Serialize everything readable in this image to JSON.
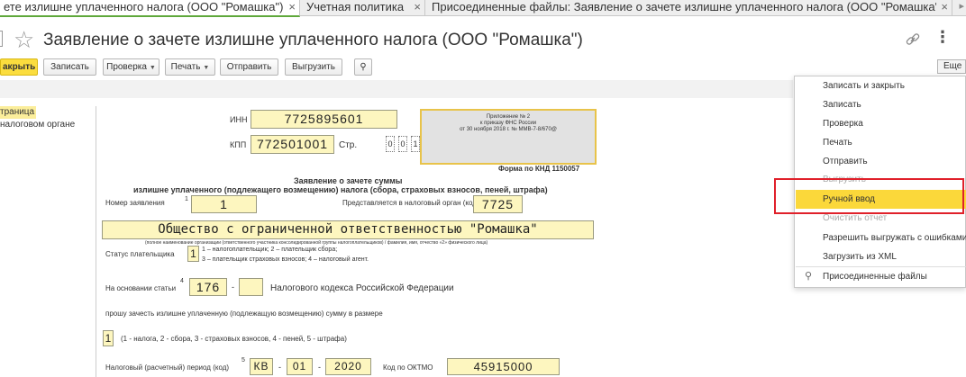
{
  "tabs": [
    {
      "label": "ете излишне уплаченного налога (ООО \"Ромашка\")",
      "close": "×"
    },
    {
      "label": "Учетная политика",
      "close": "×"
    },
    {
      "label": "Присоединенные файлы: Заявление о зачете излишне уплаченного налога (ООО \"Ромашка\")",
      "close": "×"
    }
  ],
  "tab_nav": {
    "arrow": "▸",
    "more": "⋮"
  },
  "title": "Заявление о зачете излишне уплаченного налога (ООО \"Ромашка\")",
  "toolbar": {
    "close_label": "акрыть",
    "save_label": "Записать",
    "check_label": "Проверка",
    "print_label": "Печать",
    "send_label": "Отправить",
    "export_label": "Выгрузить",
    "more_label": "Еще"
  },
  "left_panel": {
    "items": [
      "траница",
      "налоговом органе"
    ]
  },
  "form": {
    "inn_label": "ИНН",
    "inn": "7725895601",
    "kpp_label": "КПП",
    "kpp": "772501001",
    "page_label": "Стр.",
    "page_digits": [
      "0",
      "0",
      "1"
    ],
    "stamp_lines": [
      "Приложение № 2",
      "к приказу ФНС России",
      "от 30 ноября 2018 г. № ММВ-7-8/670@"
    ],
    "knd": "Форма по КНД 1150057",
    "heading1": "Заявление о зачете суммы",
    "heading2": "излишне уплаченного (подлежащего возмещению) налога (сбора, страховых взносов, пеней, штрафа)",
    "app_number_label": "Номер заявления",
    "app_number": "1",
    "tax_office_label": "Представляется в налоговый орган (код)",
    "tax_office": "7725",
    "org_name": "Общество с ограниченной ответственностью \"Ромашка\"",
    "org_hint": "(полное наименование организации (ответственного участника консолидированной группы налогоплательщиков) / фамилия, имя, отчество «2» физического лица)",
    "payer_status_label": "Статус плательщика",
    "payer_status": "1",
    "payer_status_hint1": "1 – налогоплательщик; 2 – плательщик сбора;",
    "payer_status_hint2": "3 – плательщик страховых взносов; 4 – налоговый агент.",
    "article_label": "На основании статьи",
    "article": "176",
    "article_suffix": "Налогового кодекса Российской Федерации",
    "request_text": "прошу зачесть излишне уплаченную (подлежащую возмещению) сумму в размере",
    "payment_type": "1",
    "payment_type_hint": "(1 - налога, 2 - сбора, 3 - страховых взносов, 4 - пеней, 5 - штрафа)",
    "period_label": "Налоговый (расчетный) период (код)",
    "period_code": "КВ",
    "period_num": "01",
    "period_year": "2020",
    "oktmo_label": "Код по ОКТМО",
    "oktmo": "45915000"
  },
  "menu": {
    "items": [
      "Записать и закрыть",
      "Записать",
      "Проверка",
      "Печать",
      "Отправить",
      "Выгрузить",
      "Ручной ввод",
      "Очистить отчет",
      "Разрешить выгружать с ошибками",
      "Загрузить из XML",
      "Присоединенные файлы"
    ],
    "highlighted": "Ручной ввод"
  },
  "colors": {
    "accent_yellow": "#fbd83a",
    "highlight_frame": "#e0202a",
    "active_tab_underline": "#5fa83b",
    "field_fill": "#fdf6bf"
  }
}
